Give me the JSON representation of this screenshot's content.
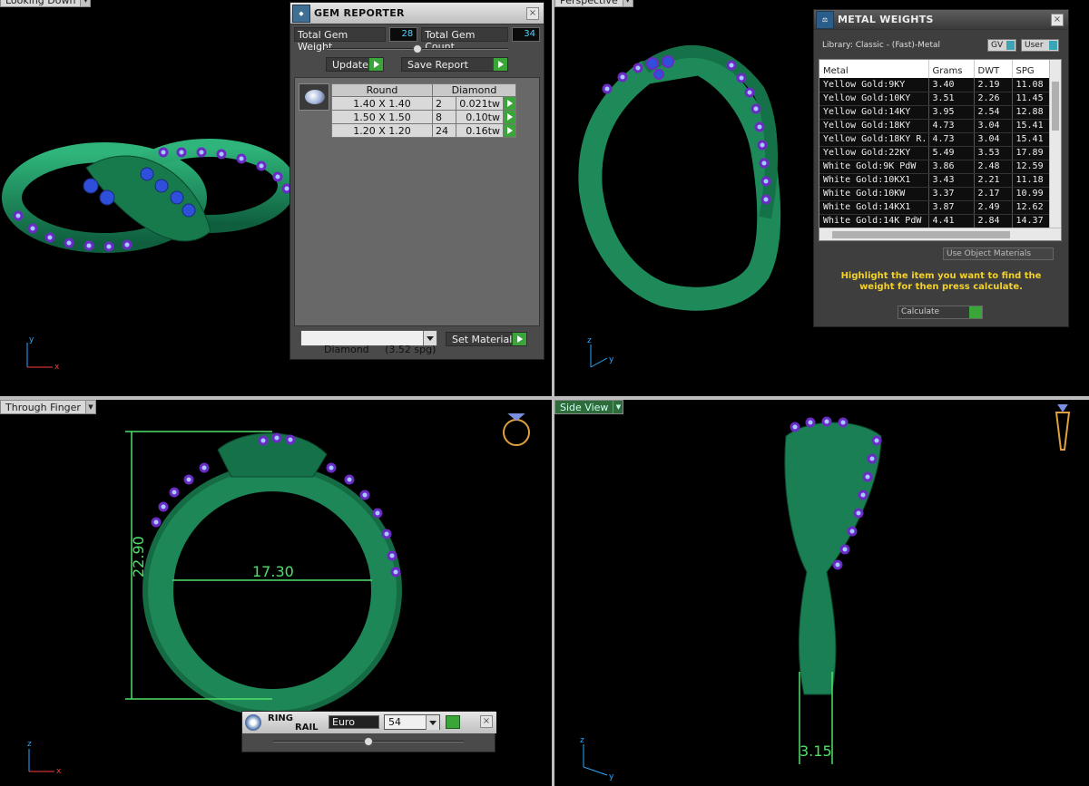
{
  "viewports": {
    "top_left": {
      "label": "Looking Down"
    },
    "top_right": {
      "label": "Perspective"
    },
    "bottom_left": {
      "label": "Through Finger",
      "dim_height": "22.90",
      "dim_width": "17.30",
      "axis_x": "x",
      "axis_y": "y"
    },
    "bottom_right": {
      "label": "Side View",
      "dim_width": "3.15",
      "axis_y": "y",
      "axis_z": "z"
    }
  },
  "axes": {
    "x": "x",
    "y": "y",
    "z": "z"
  },
  "gem_reporter": {
    "title": "GEM REPORTER",
    "total_gem_weight_label": "Total Gem Weight",
    "total_gem_weight": "28",
    "total_gem_count_label": "Total Gem Count",
    "total_gem_count": "34",
    "update_label": "Update",
    "save_report_label": "Save Report",
    "table": {
      "headers": [
        "Round",
        "Diamond"
      ],
      "rows": [
        {
          "size": "1.40 X 1.40",
          "count": "2",
          "weight": "0.021tw"
        },
        {
          "size": "1.50 X 1.50",
          "count": "8",
          "weight": "0.10tw"
        },
        {
          "size": "1.20 X 1.20",
          "count": "24",
          "weight": "0.16tw"
        }
      ]
    },
    "material_select": "Diamond     (3.52 spg)",
    "set_material_label": "Set Material",
    "slider_fraction": 0.5
  },
  "metal_weights": {
    "title": "METAL WEIGHTS",
    "library": "Library: Classic - (Fast)-Metal",
    "gv_label": "GV",
    "user_label": "User",
    "columns": [
      "Metal",
      "Grams",
      "DWT",
      "SPG"
    ],
    "rows": [
      [
        "Yellow Gold:9KY",
        "3.40",
        "2.19",
        "11.08"
      ],
      [
        "Yellow Gold:10KY",
        "3.51",
        "2.26",
        "11.45"
      ],
      [
        "Yellow Gold:14KY",
        "3.95",
        "2.54",
        "12.88"
      ],
      [
        "Yellow Gold:18KY",
        "4.73",
        "3.04",
        "15.41"
      ],
      [
        "Yellow Gold:18KY R...",
        "4.73",
        "3.04",
        "15.41"
      ],
      [
        "Yellow Gold:22KY",
        "5.49",
        "3.53",
        "17.89"
      ],
      [
        "White Gold:9K PdW",
        "3.86",
        "2.48",
        "12.59"
      ],
      [
        "White Gold:10KX1",
        "3.43",
        "2.21",
        "11.18"
      ],
      [
        "White Gold:10KW",
        "3.37",
        "2.17",
        "10.99"
      ],
      [
        "White Gold:14KX1",
        "3.87",
        "2.49",
        "12.62"
      ],
      [
        "White Gold:14K PdW",
        "4.41",
        "2.84",
        "14.37"
      ]
    ],
    "use_object_materials": "Use Object Materials",
    "hint": "Highlight the item you want to find the weight for then press calculate.",
    "calculate_label": "Calculate"
  },
  "ring_rail": {
    "title_line1": "RING",
    "title_line2": "RAIL",
    "standard": "Euro",
    "size": "54",
    "slider_fraction": 0.5
  },
  "colors": {
    "metal_green": "#1f8a5c",
    "diamond_light": "#9ec7ff",
    "prong_purple": "#7a2bd1",
    "center_blue": "#2f4fd6",
    "dim_green": "#4fe06a",
    "accent_green": "#3aa63a"
  }
}
